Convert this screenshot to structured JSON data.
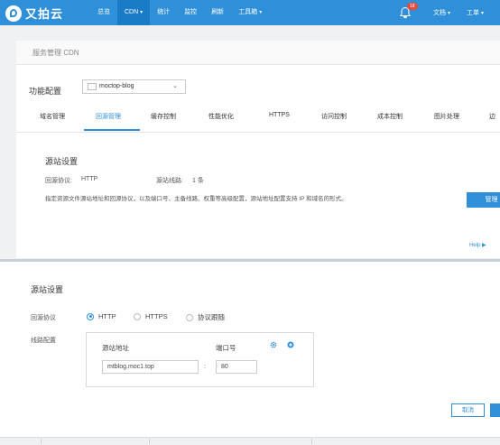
{
  "brand": {
    "name": "又拍云"
  },
  "nav": [
    {
      "label": "总览"
    },
    {
      "label": "CDN",
      "dropdown": true,
      "active": true
    },
    {
      "label": "统计"
    },
    {
      "label": "监控"
    },
    {
      "label": "刷新"
    },
    {
      "label": "工具箱",
      "dropdown": true
    }
  ],
  "top_right": {
    "notification_count": "18",
    "docs": "文档",
    "tickets": "工单"
  },
  "breadcrumb": "服务管理 CDN",
  "config": {
    "label": "功能配置",
    "service": "moctop-blog"
  },
  "tabs": [
    "域名管理",
    "回源管理",
    "缓存控制",
    "性能优化",
    "HTTPS",
    "访问控制",
    "成本控制",
    "图片处理",
    "边"
  ],
  "origin_summary": {
    "title": "源站设置",
    "protocol_label": "回源协议:",
    "protocol_value": "HTTP",
    "lines_label": "源站线路:",
    "lines_value": "1 条",
    "description": "指定资源文件源站地址和回源协议，以及端口号、主备线路、权重等高级配置，源站地址配置支持 IP 和域名的形式。",
    "manage_button": "管理",
    "help_link": "Help ▶"
  },
  "origin_form": {
    "title": "源站设置",
    "protocol_label": "回源协议",
    "protocols": [
      {
        "label": "HTTP",
        "selected": true
      },
      {
        "label": "HTTPS",
        "selected": false
      },
      {
        "label": "协议跟随",
        "selected": false
      }
    ],
    "line_config_label": "线路配置",
    "address_header": "源站地址",
    "port_header": "端口号",
    "address_value": "mtblog.moc1.top",
    "colon": ":",
    "port_value": "80",
    "cancel_button": "取消"
  },
  "colors": {
    "accent": "#2f8fd8",
    "topbar": "#2f8fd8",
    "badge": "#e84b3c"
  },
  "icons": [
    "logo-icon",
    "bell-icon",
    "chevron-down-icon",
    "gear-icon",
    "add-icon"
  ]
}
